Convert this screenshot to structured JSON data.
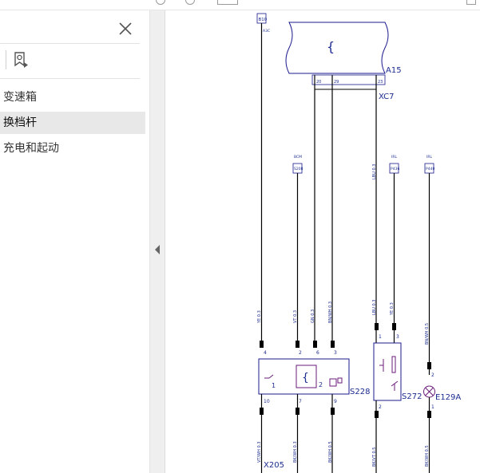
{
  "sidebar": {
    "bookmarks": [
      {
        "label": "变速箱",
        "active": false
      },
      {
        "label": "换档杆",
        "active": true
      },
      {
        "label": "充电和起动",
        "active": false
      }
    ]
  },
  "icons": {
    "close": "close-icon",
    "bookmark_settings": "bookmark-settings-icon",
    "collapse": "chevron-left-icon"
  },
  "colors": {
    "wire": "#000000",
    "module_outline": "#1a1a8c",
    "label_text": "#1c2c8f",
    "component": "#6a1b7a"
  },
  "diagram": {
    "top_tag": "B10",
    "top_tag_sub": "A3C",
    "module_name": "A15",
    "module_symbol": "{",
    "connector_top": "XC7",
    "pins_top": [
      "20",
      "29",
      "23"
    ],
    "mid_tags": [
      {
        "group": "BCM",
        "tag": "S208"
      },
      {
        "group": "IRL",
        "tag": "P436"
      },
      {
        "group": "IRL",
        "tag": "P440"
      }
    ],
    "wire_colors": {
      "ye_03": "YE 0.3",
      "lbu_03": "LBU 0.3",
      "vt_03": "VT 0.3",
      "gn_03": "GN 0.3",
      "bnwh_03": "BN/WH 0.3",
      "bnwh_05": "BN/WH 0.5",
      "bkvt_05": "BK/VT 0.5",
      "bkwh_05": "BK/WH 0.5",
      "vtwh_03": "VT/WH 0.3",
      "bkwh_03": "BK/WH 0.3"
    },
    "pin_labels": {
      "p4": "4",
      "p2": "2",
      "p6": "6",
      "p3": "3",
      "p1": "1",
      "p3b": "3",
      "p2c": "2",
      "p10": "10",
      "p7": "7",
      "p9": "9",
      "p2b": "2",
      "p1b": "1"
    },
    "switch_box": {
      "name": "S228",
      "inner_a": "1",
      "inner_b": "2",
      "symbol": "{"
    },
    "switch_s272": "S272",
    "lamp": "E129A",
    "connector_bottom": "X205"
  }
}
